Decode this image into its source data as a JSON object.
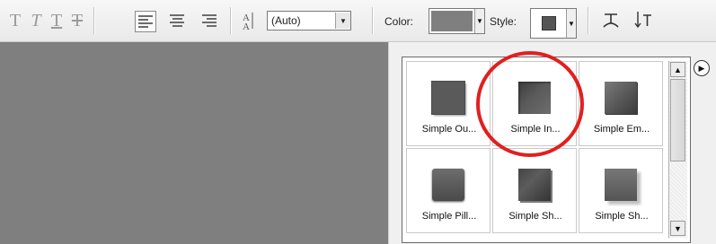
{
  "toolbar": {
    "type_style_buttons": [
      {
        "glyph": "T",
        "name": "bold"
      },
      {
        "glyph": "T",
        "name": "italic"
      },
      {
        "glyph": "T",
        "name": "underline"
      },
      {
        "glyph": "T",
        "name": "strikethrough"
      }
    ],
    "leading_value": "(Auto)",
    "color_label": "Color:",
    "color_swatch": "#7f7f7f",
    "style_label": "Style:",
    "style_swatch": "#555555",
    "combo_arrow": "▼",
    "swatch_arrow": "▼"
  },
  "canvas": {
    "background": "#7f7f7f"
  },
  "style_panel": {
    "menu_icon": "▶",
    "scroll_up": "▲",
    "scroll_down": "▼",
    "styles": [
      {
        "label": "Simple Ou...",
        "variant": "outer"
      },
      {
        "label": "Simple In...",
        "variant": "inner"
      },
      {
        "label": "Simple Em...",
        "variant": "emboss"
      },
      {
        "label": "Simple Pill...",
        "variant": "pill"
      },
      {
        "label": "Simple Sh...",
        "variant": "sharp"
      },
      {
        "label": "Simple Sh...",
        "variant": "sharp2"
      }
    ],
    "highlight_color": "#e02020"
  }
}
